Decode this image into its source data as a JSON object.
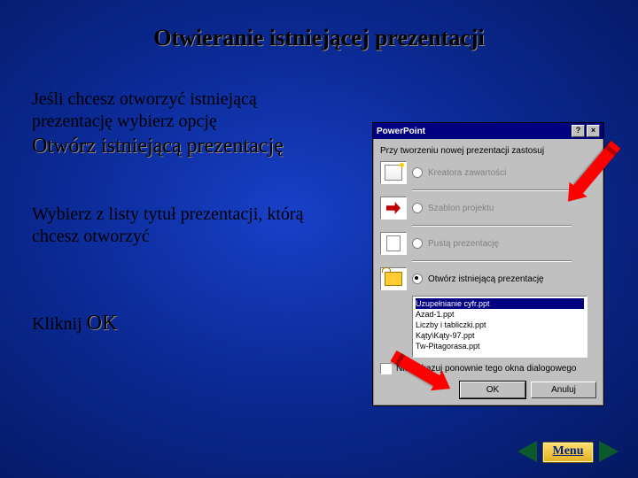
{
  "title": "Otwieranie istniejącej prezentacji",
  "para1a": "Jeśli chcesz otworzyć istniejącą prezentację wybierz opcję",
  "para1b": "Otwórz istniejącą prezentację",
  "para2": "Wybierz z listy tytuł prezentacji, którą chcesz otworzyć",
  "para3a": "Kliknij ",
  "para3b": "OK",
  "menu": "Menu",
  "dialog": {
    "title": "PowerPoint",
    "caption": "Przy tworzeniu nowej prezentacji zastosuj",
    "opts": {
      "o1": "Kreatora zawartości",
      "o2": "Szablon projektu",
      "o3": "Pustą prezentację",
      "o4": "Otwórz istniejącą prezentację"
    },
    "files": {
      "f0": "Uzupełnianie cyfr.ppt",
      "f1": "Azad-1.ppt",
      "f2": "Liczby i tabliczki.ppt",
      "f3": "Kąty\\Kąty-97.ppt",
      "f4": "Tw-Pitagorasa.ppt"
    },
    "hide": "Nie pokazuj ponownie tego okna dialogowego",
    "ok": "OK",
    "cancel": "Anuluj"
  }
}
